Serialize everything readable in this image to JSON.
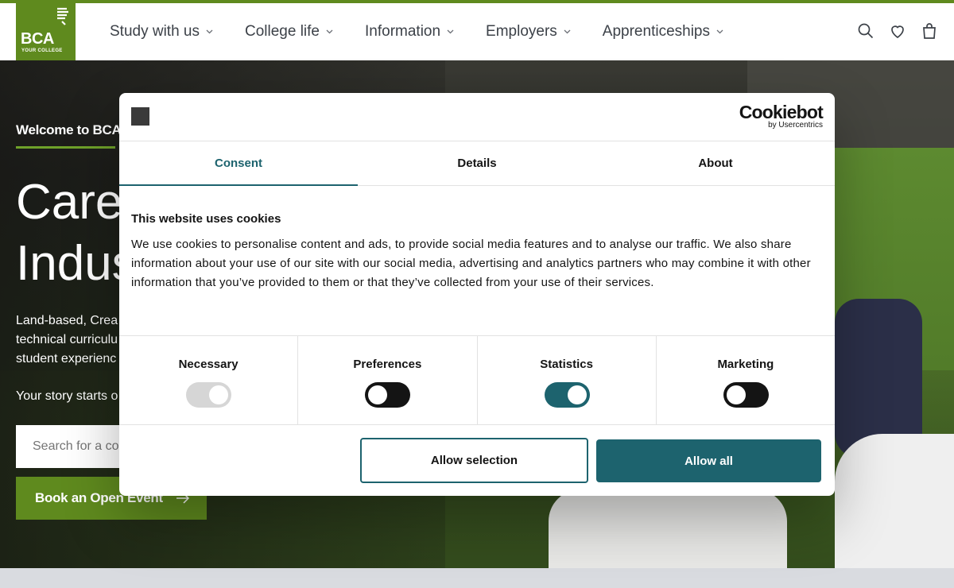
{
  "logo": {
    "text": "BCA",
    "subtext": "YOUR COLLEGE"
  },
  "nav": [
    {
      "label": "Study with us"
    },
    {
      "label": "College life"
    },
    {
      "label": "Information"
    },
    {
      "label": "Employers"
    },
    {
      "label": "Apprenticeships"
    }
  ],
  "header_icons": [
    "search-icon",
    "heart-icon",
    "bag-icon"
  ],
  "hero": {
    "welcome": "Welcome to BCA",
    "title_lines": [
      "Care",
      "Indus"
    ],
    "desc_lines": [
      "Land-based, Crea",
      "technical curriculu",
      "student experienc"
    ],
    "story": "Your story starts o",
    "search_placeholder": "Search for a co",
    "cta": "Book an Open Event"
  },
  "cookie": {
    "brand": "Cookiebot",
    "brand_sub": "by Usercentrics",
    "tabs": [
      {
        "label": "Consent",
        "active": true
      },
      {
        "label": "Details",
        "active": false
      },
      {
        "label": "About",
        "active": false
      }
    ],
    "title": "This website uses cookies",
    "text": "We use cookies to personalise content and ads, to provide social media features and to analyse our traffic. We also share information about your use of our site with our social media, advertising and analytics partners who may combine it with other information that you’ve provided to them or that they’ve collected from your use of their services.",
    "categories": [
      {
        "label": "Necessary",
        "state": "on-disabled"
      },
      {
        "label": "Preferences",
        "state": "off"
      },
      {
        "label": "Statistics",
        "state": "on"
      },
      {
        "label": "Marketing",
        "state": "off"
      }
    ],
    "allow_selection": "Allow selection",
    "allow_all": "Allow all"
  },
  "colors": {
    "brand_green": "#5f8a1e",
    "cookie_teal": "#1d636e",
    "toggle_off": "#141414",
    "toggle_disabled": "#d6d6d6"
  }
}
